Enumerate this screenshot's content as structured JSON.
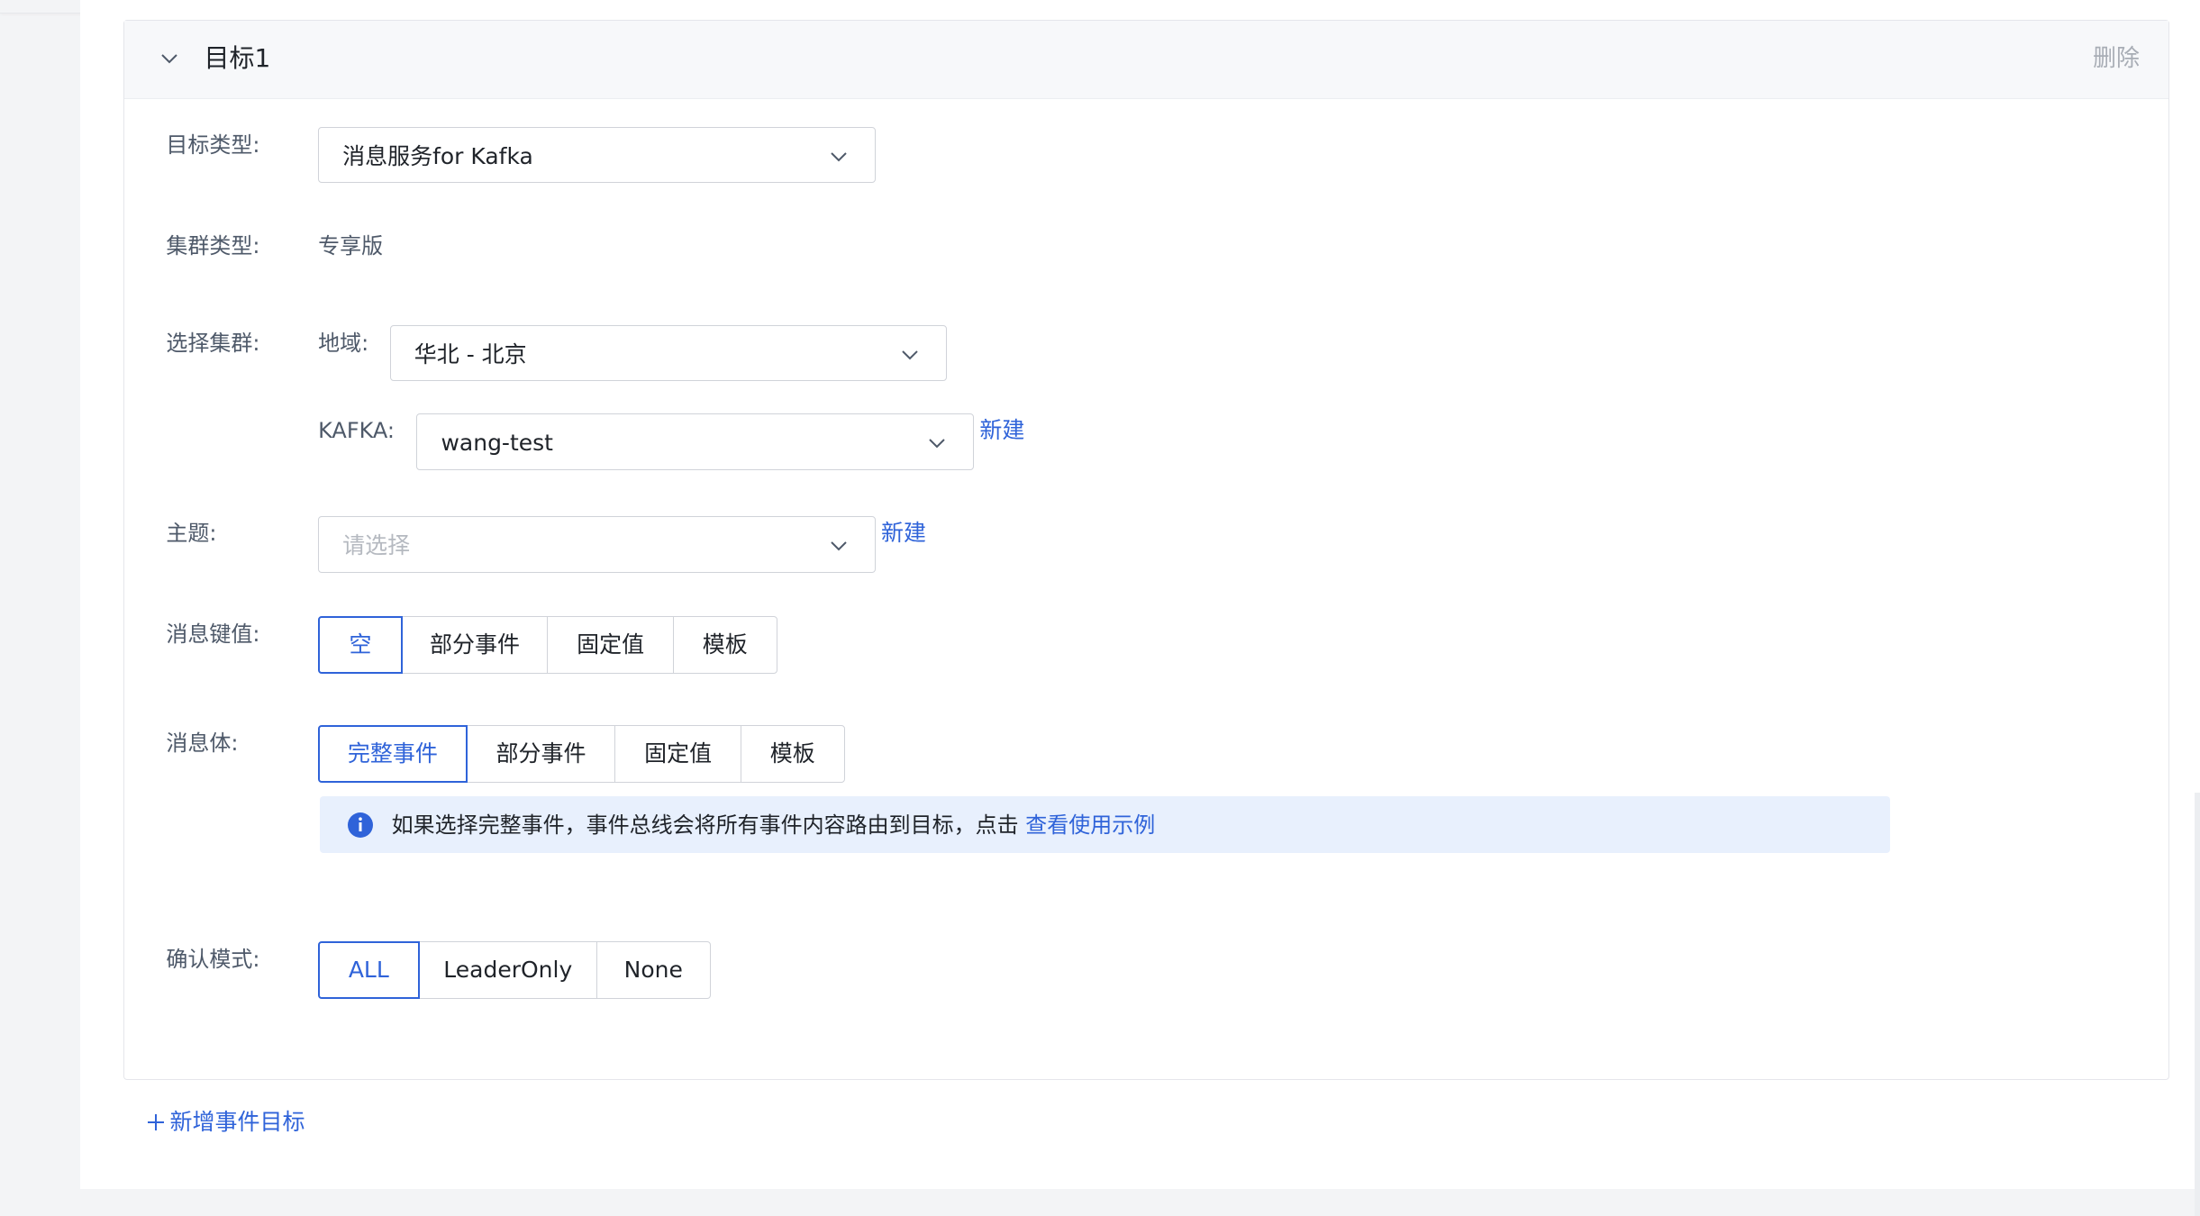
{
  "target": {
    "title": "目标1",
    "delete_label": "删除"
  },
  "form": {
    "target_type": {
      "label": "目标类型:",
      "value": "消息服务for Kafka"
    },
    "cluster_type": {
      "label": "集群类型:",
      "value": "专享版"
    },
    "cluster": {
      "label": "选择集群:",
      "region_label": "地域:",
      "region_value": "华北 - 北京",
      "kafka_label": "KAFKA:",
      "kafka_value": "wang-test",
      "create_label": "新建"
    },
    "topic": {
      "label": "主题:",
      "placeholder": "请选择",
      "create_label": "新建"
    },
    "message_key": {
      "label": "消息键值:",
      "options": [
        "空",
        "部分事件",
        "固定值",
        "模板"
      ],
      "selected": "空"
    },
    "message_body": {
      "label": "消息体:",
      "options": [
        "完整事件",
        "部分事件",
        "固定值",
        "模板"
      ],
      "selected": "完整事件",
      "info_text": "如果选择完整事件，事件总线会将所有事件内容路由到目标，点击",
      "info_link": "查看使用示例"
    },
    "ack_mode": {
      "label": "确认模式:",
      "options": [
        "ALL",
        "LeaderOnly",
        "None"
      ],
      "selected": "ALL"
    }
  },
  "add_target_label": "新增事件目标",
  "colors": {
    "primary": "#2f63d9",
    "info_bg": "#e8f0fd",
    "border": "#d0d3d9"
  },
  "icons": [
    "chevron-down-icon",
    "info-icon",
    "plus-icon"
  ]
}
